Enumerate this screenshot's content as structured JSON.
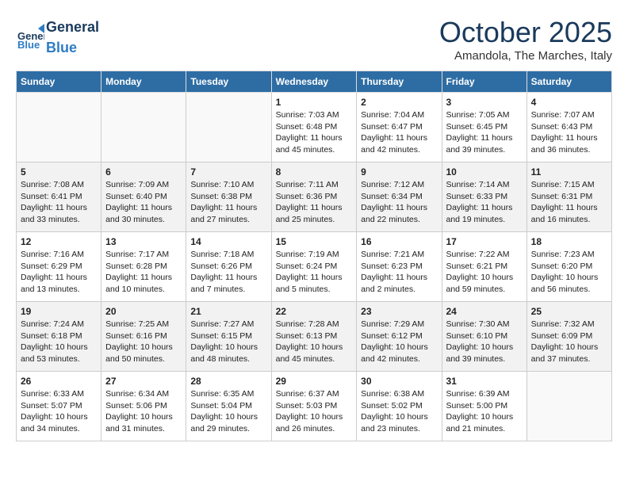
{
  "header": {
    "logo_general": "General",
    "logo_blue": "Blue",
    "month_title": "October 2025",
    "location": "Amandola, The Marches, Italy"
  },
  "weekdays": [
    "Sunday",
    "Monday",
    "Tuesday",
    "Wednesday",
    "Thursday",
    "Friday",
    "Saturday"
  ],
  "weeks": [
    [
      {
        "day": "",
        "info": ""
      },
      {
        "day": "",
        "info": ""
      },
      {
        "day": "",
        "info": ""
      },
      {
        "day": "1",
        "info": "Sunrise: 7:03 AM\nSunset: 6:48 PM\nDaylight: 11 hours and 45 minutes."
      },
      {
        "day": "2",
        "info": "Sunrise: 7:04 AM\nSunset: 6:47 PM\nDaylight: 11 hours and 42 minutes."
      },
      {
        "day": "3",
        "info": "Sunrise: 7:05 AM\nSunset: 6:45 PM\nDaylight: 11 hours and 39 minutes."
      },
      {
        "day": "4",
        "info": "Sunrise: 7:07 AM\nSunset: 6:43 PM\nDaylight: 11 hours and 36 minutes."
      }
    ],
    [
      {
        "day": "5",
        "info": "Sunrise: 7:08 AM\nSunset: 6:41 PM\nDaylight: 11 hours and 33 minutes."
      },
      {
        "day": "6",
        "info": "Sunrise: 7:09 AM\nSunset: 6:40 PM\nDaylight: 11 hours and 30 minutes."
      },
      {
        "day": "7",
        "info": "Sunrise: 7:10 AM\nSunset: 6:38 PM\nDaylight: 11 hours and 27 minutes."
      },
      {
        "day": "8",
        "info": "Sunrise: 7:11 AM\nSunset: 6:36 PM\nDaylight: 11 hours and 25 minutes."
      },
      {
        "day": "9",
        "info": "Sunrise: 7:12 AM\nSunset: 6:34 PM\nDaylight: 11 hours and 22 minutes."
      },
      {
        "day": "10",
        "info": "Sunrise: 7:14 AM\nSunset: 6:33 PM\nDaylight: 11 hours and 19 minutes."
      },
      {
        "day": "11",
        "info": "Sunrise: 7:15 AM\nSunset: 6:31 PM\nDaylight: 11 hours and 16 minutes."
      }
    ],
    [
      {
        "day": "12",
        "info": "Sunrise: 7:16 AM\nSunset: 6:29 PM\nDaylight: 11 hours and 13 minutes."
      },
      {
        "day": "13",
        "info": "Sunrise: 7:17 AM\nSunset: 6:28 PM\nDaylight: 11 hours and 10 minutes."
      },
      {
        "day": "14",
        "info": "Sunrise: 7:18 AM\nSunset: 6:26 PM\nDaylight: 11 hours and 7 minutes."
      },
      {
        "day": "15",
        "info": "Sunrise: 7:19 AM\nSunset: 6:24 PM\nDaylight: 11 hours and 5 minutes."
      },
      {
        "day": "16",
        "info": "Sunrise: 7:21 AM\nSunset: 6:23 PM\nDaylight: 11 hours and 2 minutes."
      },
      {
        "day": "17",
        "info": "Sunrise: 7:22 AM\nSunset: 6:21 PM\nDaylight: 10 hours and 59 minutes."
      },
      {
        "day": "18",
        "info": "Sunrise: 7:23 AM\nSunset: 6:20 PM\nDaylight: 10 hours and 56 minutes."
      }
    ],
    [
      {
        "day": "19",
        "info": "Sunrise: 7:24 AM\nSunset: 6:18 PM\nDaylight: 10 hours and 53 minutes."
      },
      {
        "day": "20",
        "info": "Sunrise: 7:25 AM\nSunset: 6:16 PM\nDaylight: 10 hours and 50 minutes."
      },
      {
        "day": "21",
        "info": "Sunrise: 7:27 AM\nSunset: 6:15 PM\nDaylight: 10 hours and 48 minutes."
      },
      {
        "day": "22",
        "info": "Sunrise: 7:28 AM\nSunset: 6:13 PM\nDaylight: 10 hours and 45 minutes."
      },
      {
        "day": "23",
        "info": "Sunrise: 7:29 AM\nSunset: 6:12 PM\nDaylight: 10 hours and 42 minutes."
      },
      {
        "day": "24",
        "info": "Sunrise: 7:30 AM\nSunset: 6:10 PM\nDaylight: 10 hours and 39 minutes."
      },
      {
        "day": "25",
        "info": "Sunrise: 7:32 AM\nSunset: 6:09 PM\nDaylight: 10 hours and 37 minutes."
      }
    ],
    [
      {
        "day": "26",
        "info": "Sunrise: 6:33 AM\nSunset: 5:07 PM\nDaylight: 10 hours and 34 minutes."
      },
      {
        "day": "27",
        "info": "Sunrise: 6:34 AM\nSunset: 5:06 PM\nDaylight: 10 hours and 31 minutes."
      },
      {
        "day": "28",
        "info": "Sunrise: 6:35 AM\nSunset: 5:04 PM\nDaylight: 10 hours and 29 minutes."
      },
      {
        "day": "29",
        "info": "Sunrise: 6:37 AM\nSunset: 5:03 PM\nDaylight: 10 hours and 26 minutes."
      },
      {
        "day": "30",
        "info": "Sunrise: 6:38 AM\nSunset: 5:02 PM\nDaylight: 10 hours and 23 minutes."
      },
      {
        "day": "31",
        "info": "Sunrise: 6:39 AM\nSunset: 5:00 PM\nDaylight: 10 hours and 21 minutes."
      },
      {
        "day": "",
        "info": ""
      }
    ]
  ]
}
